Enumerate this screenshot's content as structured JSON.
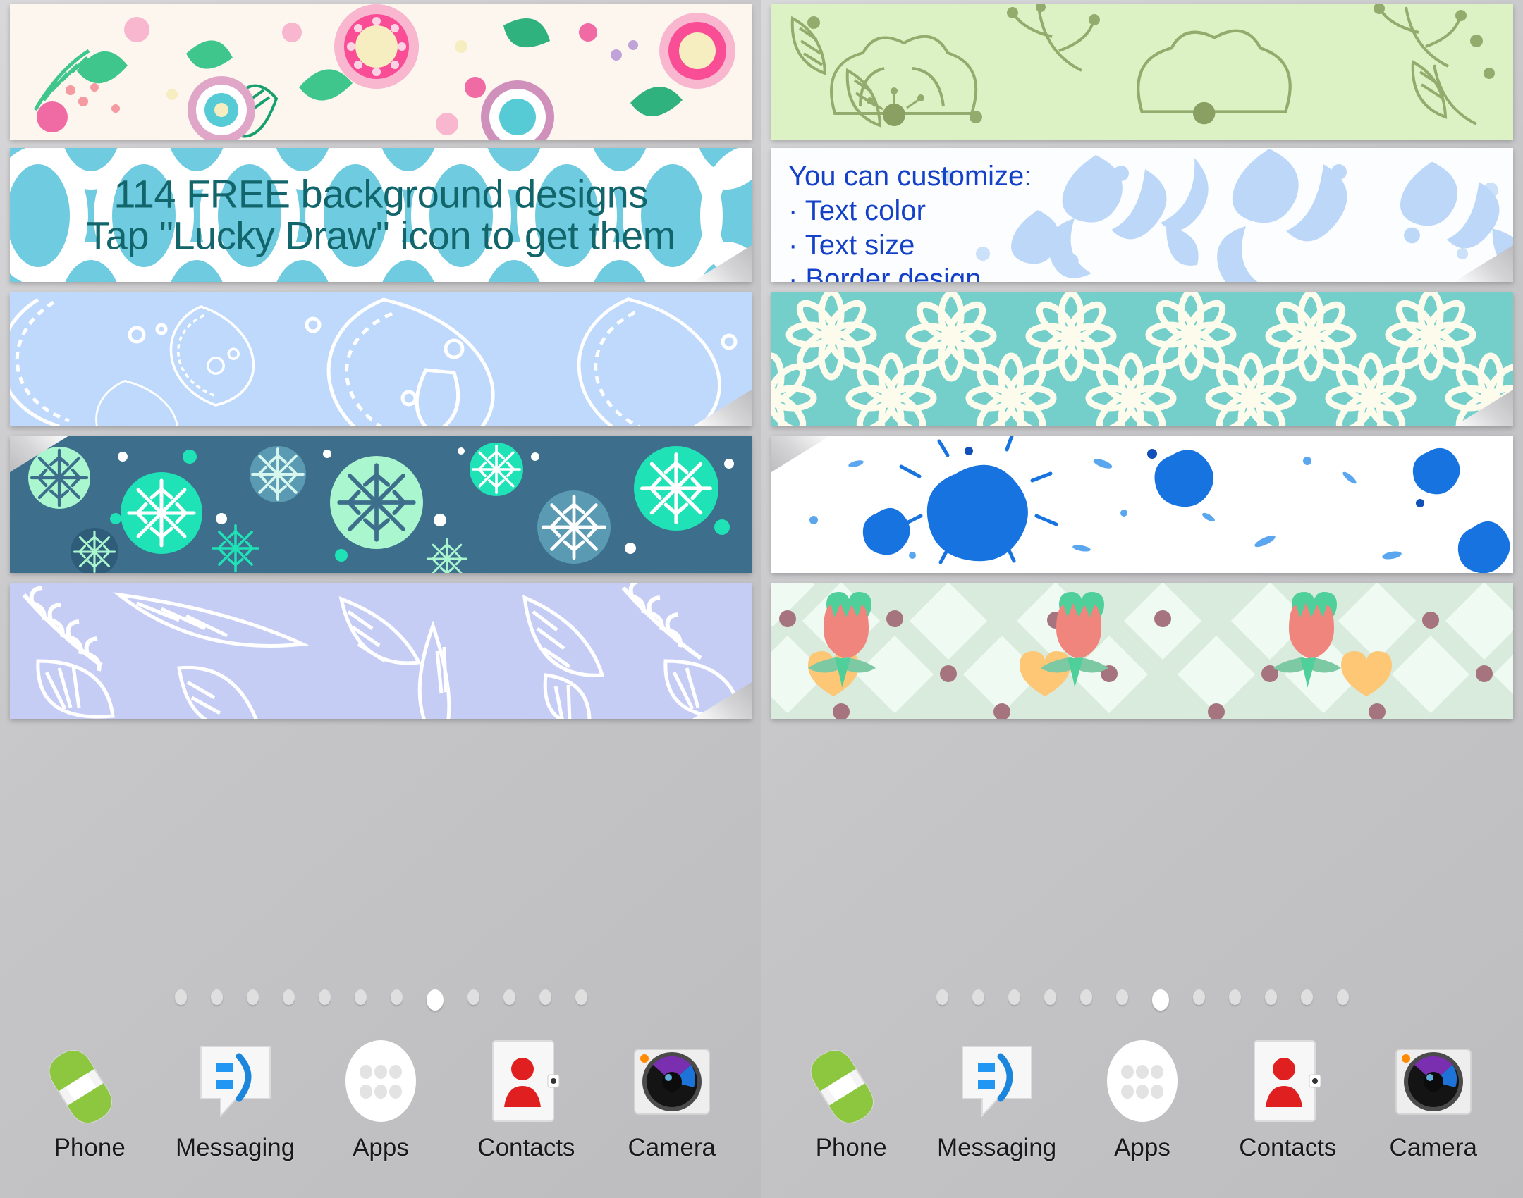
{
  "app": {
    "screens": [
      {
        "id": "left-home-screen",
        "headline": {
          "line1": "114 FREE background designs",
          "line2": "Tap \"Lucky Draw\" icon to get them"
        },
        "page_dots": {
          "count": 12,
          "active_index": 7
        }
      },
      {
        "id": "right-home-screen",
        "customize": {
          "title": "You can customize:",
          "items": [
            "· Text color",
            "· Text size",
            "· Border design"
          ]
        },
        "page_dots": {
          "count": 12,
          "active_index": 6
        }
      }
    ]
  },
  "dock": {
    "items": [
      {
        "label": "Phone",
        "icon": "phone-handset-icon"
      },
      {
        "label": "Messaging",
        "icon": "message-bubble-icon"
      },
      {
        "label": "Apps",
        "icon": "apps-grid-icon"
      },
      {
        "label": "Contacts",
        "icon": "contacts-person-icon"
      },
      {
        "label": "Camera",
        "icon": "camera-lens-icon"
      }
    ]
  },
  "strips": {
    "left": [
      {
        "name": "bright-floral-pattern",
        "background": "#fdf6ee",
        "accent": "#f94d96"
      },
      {
        "name": "big-circles-pattern",
        "background": "#6ecbe0",
        "accent": "#ffffff"
      },
      {
        "name": "paisley-pattern",
        "background": "#bed9fb",
        "accent": "#ffffff"
      },
      {
        "name": "snowflake-medallion-pattern",
        "background": "#3d6e8c",
        "accent": "#1fe3b6"
      },
      {
        "name": "white-leaves-pattern",
        "background": "#c6cdf5",
        "accent": "#ffffff"
      }
    ],
    "right": [
      {
        "name": "green-line-floral-pattern",
        "background": "#ddf2c4",
        "accent": "#8fa868"
      },
      {
        "name": "blue-damask-pattern",
        "background": "#fbfdff",
        "accent": "#bcd7f7"
      },
      {
        "name": "teal-daisy-pattern",
        "background": "#74cfcb",
        "accent": "#fdfbec"
      },
      {
        "name": "blue-ink-splatter-pattern",
        "background": "#ffffff",
        "accent": "#1773e0"
      },
      {
        "name": "mint-diamond-tulip-pattern",
        "background": "#d8ebdd",
        "accent": "#f0857e"
      }
    ]
  },
  "colors": {
    "headline_text": "#12656a",
    "customize_text": "#1540c8",
    "wallpaper_grey": "#c9c9cb"
  }
}
